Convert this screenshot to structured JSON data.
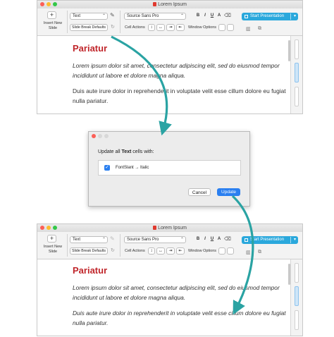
{
  "window": {
    "title": "Lorem Ipsum",
    "traffic_lights": [
      "#fc5f57",
      "#fdbc2e",
      "#33c748"
    ]
  },
  "toolbar": {
    "insert_slide_label": "Insert New Slide",
    "style_select": "Text",
    "font_select": "Source Sans Pro",
    "bold": "B",
    "italic": "I",
    "underline": "U",
    "font_color": "A",
    "slide_break_defaults": "Slide Break Defaults",
    "cell_actions": "Cell Actions",
    "window_options": "Window Options",
    "start_presentation": "Start Presentation",
    "accent": "#2aa8dc"
  },
  "document": {
    "heading": "Pariatur",
    "heading_color": "#c0252a",
    "para1": "Lorem ipsum dolor sit amet, consectetur adipiscing elit, sed do eiusmod tempor incididunt ut labore et dolore magna aliqua.",
    "para2": "Duis aute irure dolor in reprehenderit in voluptate velit esse cillum dolore eu fugiat nulla pariatur."
  },
  "dialog": {
    "title_prefix": "Update all ",
    "title_bold": "Text",
    "title_suffix": " cells with:",
    "option_label": "FontSlant → Italic",
    "option_checked": true,
    "cancel_label": "Cancel",
    "update_label": "Update",
    "accent": "#2a7ff0"
  },
  "arrow_color": "#2aa3a3"
}
